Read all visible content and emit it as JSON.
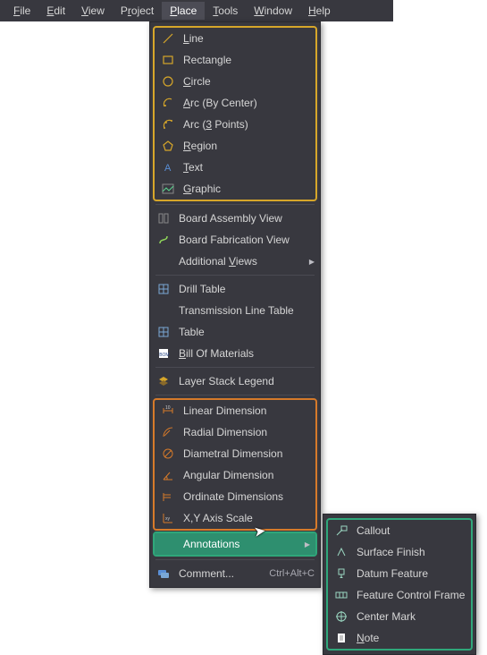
{
  "menubar": {
    "items": [
      {
        "label": "File",
        "u": "F"
      },
      {
        "label": "Edit",
        "u": "E"
      },
      {
        "label": "View",
        "u": "V"
      },
      {
        "label": "Project",
        "u": "r"
      },
      {
        "label": "Place",
        "u": "P"
      },
      {
        "label": "Tools",
        "u": "T"
      },
      {
        "label": "Window",
        "u": "W"
      },
      {
        "label": "Help",
        "u": "H"
      }
    ],
    "active": 4
  },
  "menu_place": {
    "group_primitives": [
      {
        "label": "Line",
        "u": "L",
        "icon": "line"
      },
      {
        "label": "Rectangle",
        "u": "",
        "icon": "rect"
      },
      {
        "label": "Circle",
        "u": "C",
        "icon": "circle"
      },
      {
        "label": "Arc (By Center)",
        "u": "A",
        "icon": "arc-center"
      },
      {
        "label": "Arc (3 Points)",
        "u": "3",
        "icon": "arc-3pt"
      },
      {
        "label": "Region",
        "u": "R",
        "icon": "region"
      },
      {
        "label": "Text",
        "u": "T",
        "icon": "text"
      },
      {
        "label": "Graphic",
        "u": "G",
        "icon": "graphic"
      }
    ],
    "group_views": [
      {
        "label": "Board Assembly View",
        "u": "",
        "icon": "board-asm"
      },
      {
        "label": "Board Fabrication View",
        "u": "",
        "icon": "board-fab"
      },
      {
        "label": "Additional Views",
        "u": "V",
        "icon": "",
        "submenu": true
      }
    ],
    "group_tables": [
      {
        "label": "Drill Table",
        "u": "",
        "icon": "grid"
      },
      {
        "label": "Transmission Line Table",
        "u": "",
        "icon": ""
      },
      {
        "label": "Table",
        "u": "",
        "icon": "grid"
      },
      {
        "label": "Bill Of Materials",
        "u": "B",
        "icon": "bom"
      }
    ],
    "group_legend": [
      {
        "label": "Layer Stack Legend",
        "u": "",
        "icon": "layers"
      }
    ],
    "group_dimensions": [
      {
        "label": "Linear Dimension",
        "u": "",
        "icon": "dim-lin"
      },
      {
        "label": "Radial Dimension",
        "u": "",
        "icon": "dim-rad"
      },
      {
        "label": "Diametral Dimension",
        "u": "",
        "icon": "dim-dia"
      },
      {
        "label": "Angular Dimension",
        "u": "",
        "icon": "dim-ang"
      },
      {
        "label": "Ordinate Dimensions",
        "u": "",
        "icon": "dim-ord"
      },
      {
        "label": "X,Y Axis Scale",
        "u": "",
        "icon": "dim-xy"
      }
    ],
    "group_annotations": [
      {
        "label": "Annotations",
        "u": "",
        "icon": "",
        "submenu": true,
        "highlight": true
      }
    ],
    "group_comment": [
      {
        "label": "Comment...",
        "u": "",
        "icon": "comment",
        "shortcut": "Ctrl+Alt+C"
      }
    ]
  },
  "menu_annotations": [
    {
      "label": "Callout",
      "u": "",
      "icon": "callout"
    },
    {
      "label": "Surface Finish",
      "u": "",
      "icon": "surface"
    },
    {
      "label": "Datum Feature",
      "u": "",
      "icon": "datum"
    },
    {
      "label": "Feature Control Frame",
      "u": "",
      "icon": "fcf"
    },
    {
      "label": "Center Mark",
      "u": "",
      "icon": "centermark"
    },
    {
      "label": "Note",
      "u": "N",
      "icon": "note"
    }
  ],
  "colors": {
    "bg": "#38383f",
    "fg": "#d6d6d6",
    "hl": "#2e8f6f",
    "grp_yellow": "#d6a62a",
    "grp_orange": "#d67a2a",
    "grp_green": "#2fa77a"
  }
}
